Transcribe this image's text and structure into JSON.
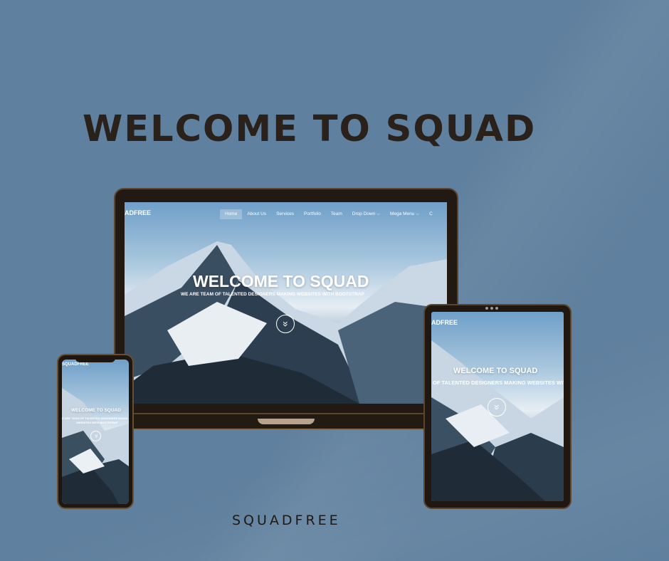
{
  "headline": "WELCOME TO SQUAD",
  "footer_brand": "SQUADFREE",
  "laptop": {
    "logo": "ADFREE",
    "nav": [
      "Home",
      "About Us",
      "Services",
      "Portfolio",
      "Team",
      "Drop Down ⌵",
      "Mega Menu ⌵",
      "C"
    ],
    "active_nav": "Home",
    "hero_title": "WELCOME TO SQUAD",
    "hero_subtitle": "WE ARE TEAM OF TALENTED DESIGNERS MAKING WEBSITES WITH BOOTSTRAP",
    "scroll_icon": "»"
  },
  "tablet": {
    "logo": "ADFREE",
    "hero_title": "WELCOME TO SQUAD",
    "hero_subtitle": "OF TALENTED DESIGNERS MAKING WEBSITES WITH",
    "scroll_icon": "»"
  },
  "phone": {
    "logo": "SQUADFREE",
    "hero_title": "WELCOME TO SQUAD",
    "hero_subtitle_line1": "E ARE TEAM OF TALENTED DESIGNERS MAKIN",
    "hero_subtitle_line2": "WEBSITES WITH BOOTSTRAP",
    "scroll_icon": "»"
  },
  "colors": {
    "background": "#5f809e",
    "device_frame": "#221a12",
    "headline": "#2a211b"
  }
}
